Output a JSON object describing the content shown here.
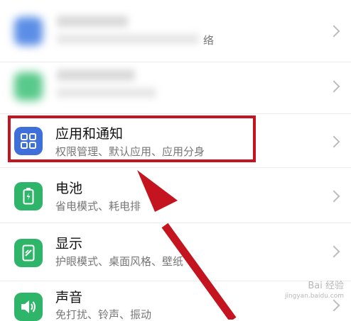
{
  "settings": {
    "items": [
      {
        "id": "network",
        "title": "",
        "subtitle": "络",
        "icon": "network-icon",
        "color": "#5b8ee6",
        "blurred": true
      },
      {
        "id": "device-connect",
        "title": "",
        "subtitle": "",
        "icon": "device-icon",
        "color": "#59c98a",
        "blurred": true
      },
      {
        "id": "apps",
        "title": "应用和通知",
        "subtitle": "权限管理、默认应用、应用分身",
        "icon": "apps-grid-icon",
        "color": "#3f6fd8",
        "highlighted": true
      },
      {
        "id": "battery",
        "title": "电池",
        "subtitle": "省电模式、耗电排",
        "icon": "battery-icon",
        "color": "#2fb56a"
      },
      {
        "id": "display",
        "title": "显示",
        "subtitle": "护眼模式、桌面风格、壁纸",
        "icon": "display-icon",
        "color": "#2fb56a"
      },
      {
        "id": "sound",
        "title": "声音",
        "subtitle": "免打扰、铃声、振动",
        "icon": "speaker-icon",
        "color": "#2fb56a"
      }
    ]
  },
  "annotation": {
    "highlight_color": "#c4141f",
    "arrow_color": "#c4141f"
  },
  "watermark": {
    "text": "Bai 经验",
    "sub": "jingyan.baidu.com"
  }
}
